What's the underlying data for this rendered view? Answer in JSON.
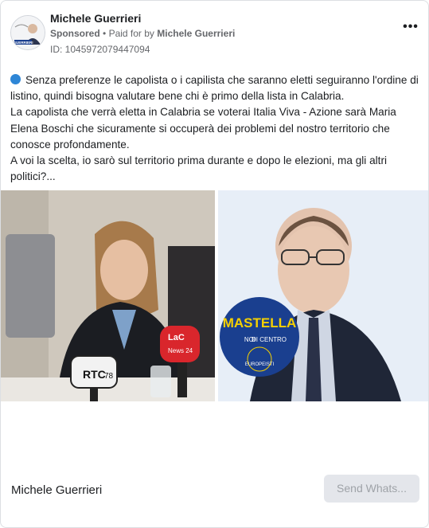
{
  "advertiser": {
    "name": "Michele Guerrieri",
    "sponsored_label": "Sponsored",
    "paid_for_prefix": "Paid for by",
    "paid_for_name": "Michele Guerrieri",
    "ad_id": "ID: 1045972079447094",
    "avatar_text": "GUERRIERI"
  },
  "post": {
    "paragraph1": "Senza preferenze le capolista o i capilista che saranno eletti seguiranno l'ordine di listino, quindi bisogna valutare bene chi è primo della lista in Calabria.",
    "paragraph2": "La capolista che verrà eletta in Calabria se voterai Italia Viva - Azione sarà Maria Elena Boschi che sicuramente si occuperà dei problemi del nostro territorio che conosce profondamente.",
    "paragraph3": "A voi la scelta, io sarò sul territorio prima durante e dopo le elezioni, ma gli altri politici?..."
  },
  "images": {
    "left": {
      "mic1": "RTC",
      "mic1_sub": "78",
      "mic2": "LaC",
      "mic2_sub": "News 24"
    },
    "right": {
      "logo_title": "MASTELLA",
      "logo_sub1": "NOI",
      "logo_sub2": "DI CENTRO",
      "logo_badge": "EUROPEISTI"
    }
  },
  "footer": {
    "name": "Michele Guerrieri",
    "cta_label": "Send Whats..."
  },
  "colors": {
    "accent_dot": "#2e86d6",
    "mastella_blue": "#1a3f8f",
    "mastella_yellow": "#f5d000"
  }
}
